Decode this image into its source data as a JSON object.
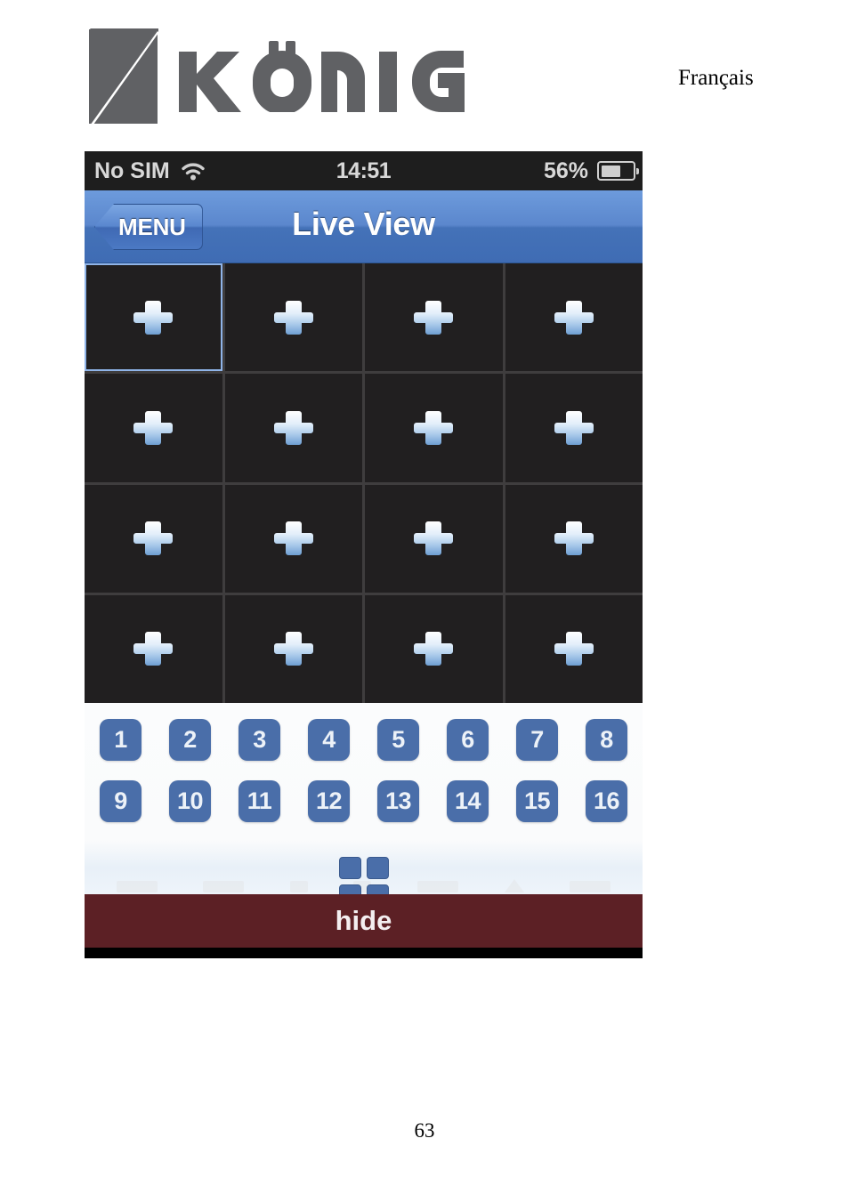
{
  "document": {
    "language_label": "Français",
    "page_number": "63",
    "brand": {
      "name": "KÖNIG",
      "logo_icon": "konig-k-logo",
      "color": "#606164"
    }
  },
  "phone": {
    "status_bar": {
      "carrier": "No SIM",
      "wifi_icon": "wifi-icon",
      "time": "14:51",
      "battery_percent": "56%",
      "battery_level": 56,
      "battery_icon": "battery-icon"
    },
    "nav_bar": {
      "back_label": "MENU",
      "title": "Live View",
      "accent_color": "#4472b8"
    },
    "video_grid": {
      "columns": 4,
      "rows": 4,
      "selected_index": 0,
      "cell_icon": "plus-icon",
      "cells": [
        {
          "id": "cell-1",
          "icon": "plus-icon",
          "selected": true
        },
        {
          "id": "cell-2",
          "icon": "plus-icon",
          "selected": false
        },
        {
          "id": "cell-3",
          "icon": "plus-icon",
          "selected": false
        },
        {
          "id": "cell-4",
          "icon": "plus-icon",
          "selected": false
        },
        {
          "id": "cell-5",
          "icon": "plus-icon",
          "selected": false
        },
        {
          "id": "cell-6",
          "icon": "plus-icon",
          "selected": false
        },
        {
          "id": "cell-7",
          "icon": "plus-icon",
          "selected": false
        },
        {
          "id": "cell-8",
          "icon": "plus-icon",
          "selected": false
        },
        {
          "id": "cell-9",
          "icon": "plus-icon",
          "selected": false
        },
        {
          "id": "cell-10",
          "icon": "plus-icon",
          "selected": false
        },
        {
          "id": "cell-11",
          "icon": "plus-icon",
          "selected": false
        },
        {
          "id": "cell-12",
          "icon": "plus-icon",
          "selected": false
        },
        {
          "id": "cell-13",
          "icon": "plus-icon",
          "selected": false
        },
        {
          "id": "cell-14",
          "icon": "plus-icon",
          "selected": false
        },
        {
          "id": "cell-15",
          "icon": "plus-icon",
          "selected": false
        },
        {
          "id": "cell-16",
          "icon": "plus-icon",
          "selected": false
        }
      ]
    },
    "channel_panel": {
      "button_color": "#4a6ea9",
      "row_1": [
        "1",
        "2",
        "3",
        "4",
        "5",
        "6",
        "7",
        "8"
      ],
      "row_2": [
        "9",
        "10",
        "11",
        "12",
        "13",
        "14",
        "15",
        "16"
      ],
      "layout_icon": "grid-2x2-layout-icon"
    },
    "hide_bar": {
      "label": "hide",
      "color": "#5c2025"
    }
  }
}
